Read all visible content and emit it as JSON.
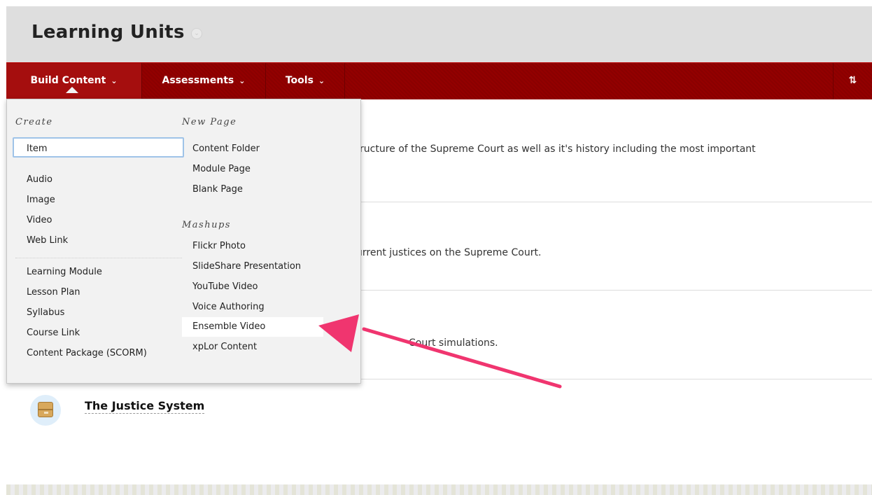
{
  "header": {
    "title": "Learning Units",
    "title_chevron": "⌄"
  },
  "toolbar": {
    "build_content": "Build Content",
    "assessments": "Assessments",
    "tools": "Tools",
    "chevron": "⌄",
    "sort": "⇅"
  },
  "rows": [
    {
      "desc": "ructure of the Supreme Court as well as it's  history  including the most important"
    },
    {
      "desc": "ırrent justices on the Supreme Court."
    },
    {
      "desc": "Court simulations."
    }
  ],
  "item": {
    "title": "The Justice System",
    "icon": "content-package-icon"
  },
  "menu": {
    "create": {
      "heading": "Create",
      "items": [
        "Item",
        "Audio",
        "Image",
        "Video",
        "Web Link",
        "Learning Module",
        "Lesson Plan",
        "Syllabus",
        "Course Link",
        "Content Package (SCORM)"
      ]
    },
    "new_page": {
      "heading": "New Page",
      "items": [
        "Content Folder",
        "Module Page",
        "Blank Page"
      ]
    },
    "mashups": {
      "heading": "Mashups",
      "items": [
        "Flickr Photo",
        "SlideShare Presentation",
        "YouTube Video",
        "Voice Authoring",
        "Ensemble Video",
        "xpLor Content"
      ]
    }
  },
  "annotation": {
    "arrow_color": "#f0356f"
  },
  "colors": {
    "toolbar": "#930000",
    "header": "#dedede"
  }
}
